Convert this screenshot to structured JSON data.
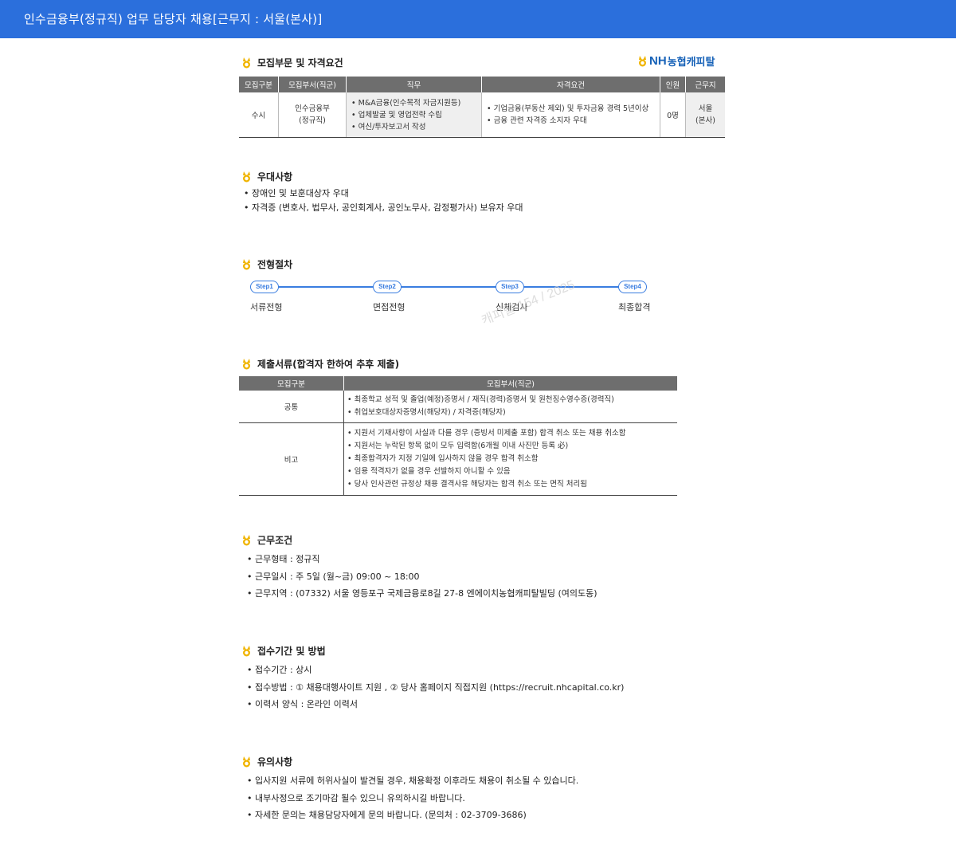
{
  "header": {
    "title": "인수금융부(정규직) 업무 담당자 채용[근무지 : 서울(본사)]"
  },
  "logo": {
    "brand": "NH",
    "name": "농협캐피탈"
  },
  "sections": {
    "recruit": "모집부문 및 자격요건",
    "preferred": "우대사항",
    "process": "전형절차",
    "documents": "제출서류(합격자 한하여 추후 제출)",
    "conditions": "근무조건",
    "apply": "접수기간 및 방법",
    "notice": "유의사항"
  },
  "recruit_table": {
    "headers": [
      "모집구분",
      "모집부서(직군)",
      "직무",
      "자격요건",
      "인원",
      "근무지"
    ],
    "row": {
      "type": "수시",
      "dept_line1": "인수금융부",
      "dept_line2": "(정규직)",
      "duties": [
        "• M&A금융(인수목적 자금지원등)",
        "• 업체발굴 및 영업전략 수립",
        "• 여신/투자보고서 작성"
      ],
      "qualifications": [
        "• 기업금융(부동산 제외) 및 투자금융 경력 5년이상",
        "• 금융 관련 자격증 소지자 우대"
      ],
      "count": "0명",
      "location_line1": "서울",
      "location_line2": "(본사)"
    }
  },
  "preferred": [
    "장애인 및 보훈대상자 우대",
    "자격증 (변호사, 법무사, 공인회계사, 공인노무사, 감정평가사) 보유자 우대"
  ],
  "process_steps": [
    {
      "step": "Step1",
      "label": "서류전형"
    },
    {
      "step": "Step2",
      "label": "면접전형"
    },
    {
      "step": "Step3",
      "label": "신체검사"
    },
    {
      "step": "Step4",
      "label": "최종합격"
    }
  ],
  "watermark": "캐피탈 154 / 2025",
  "documents_table": {
    "headers": [
      "모집구분",
      "모집부서(직군)"
    ],
    "rows": [
      {
        "category": "공통",
        "items": [
          "• 최종학교 성적 및 졸업(예정)증명서 / 재직(경력)증명서 및 원천징수영수증(경력직)",
          "• 취업보호대상자증명서(해당자) / 자격증(해당자)"
        ]
      },
      {
        "category": "비고",
        "items": [
          "• 지원서 기재사항이 사실과 다를 경우 (증빙서 미제출 포함) 합격 취소 또는 채용 취소함",
          "• 지원서는 누락된 항목 없이 모두 입력함(6개월 이내 사진만 등록 必)",
          "• 최종합격자가 지정 기일에 입사하지 않을 경우 합격 취소함",
          "• 임용 적격자가 없을 경우 선발하지 아니할 수 있음",
          "• 당사 인사관련 규정상 채용 결격사유 해당자는 합격 취소 또는 면직 처리됨"
        ]
      }
    ]
  },
  "conditions": [
    "근무형태 : 정규직",
    "근무일시 : 주 5일 (월~금) 09:00 ~ 18:00",
    "근무지역 : (07332) 서울 영등포구 국제금융로8길 27-8 엔에이치농협캐피탈빌딩 (여의도동)"
  ],
  "apply": [
    "접수기간 : 상시",
    "접수방법 : ① 채용대행사이트 지원 , ② 당사 홈페이지 직접지원 (https://recruit.nhcapital.co.kr)",
    "이력서 양식 : 온라인 이력서"
  ],
  "notice": [
    "입사지원 서류에 허위사실이 발견될 경우, 채용확정 이후라도 채용이 취소될 수 있습니다.",
    "내부사정으로 조기마감 될수 있으니 유의하시길 바랍니다.",
    "자세한 문의는 채용담당자에게 문의 바랍니다. (문의처 : 02-3709-3686)"
  ],
  "colors": {
    "header_bg": "#2b6fdc",
    "accent": "#3a7de0",
    "table_header": "#6e6e6e",
    "medal": "#f0b400"
  }
}
